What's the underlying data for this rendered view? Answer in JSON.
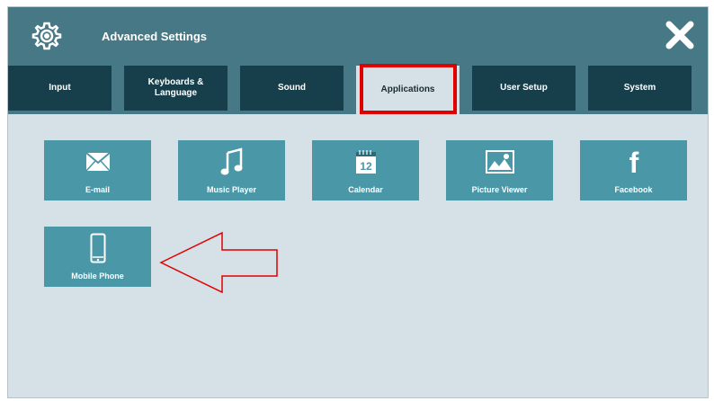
{
  "window": {
    "title": "Advanced Settings"
  },
  "tabs": [
    {
      "label": "Input"
    },
    {
      "label": "Keyboards &\nLanguage"
    },
    {
      "label": "Sound"
    },
    {
      "label": "Applications",
      "active": true
    },
    {
      "label": "User Setup"
    },
    {
      "label": "System"
    }
  ],
  "tiles": [
    {
      "label": "E-mail",
      "icon": "email-icon"
    },
    {
      "label": "Music Player",
      "icon": "music-note-icon"
    },
    {
      "label": "Calendar",
      "icon": "calendar-icon",
      "icon_text": "12"
    },
    {
      "label": "Picture Viewer",
      "icon": "picture-icon"
    },
    {
      "label": "Facebook",
      "icon": "facebook-icon",
      "icon_text": "f"
    },
    {
      "label": "Mobile Phone",
      "icon": "mobile-phone-icon"
    }
  ],
  "colors": {
    "titlebar": "#477885",
    "tab_inactive": "#163f4b",
    "tile": "#4a97a8",
    "background": "#d5e1e6",
    "annotation_red": "#e00000"
  }
}
